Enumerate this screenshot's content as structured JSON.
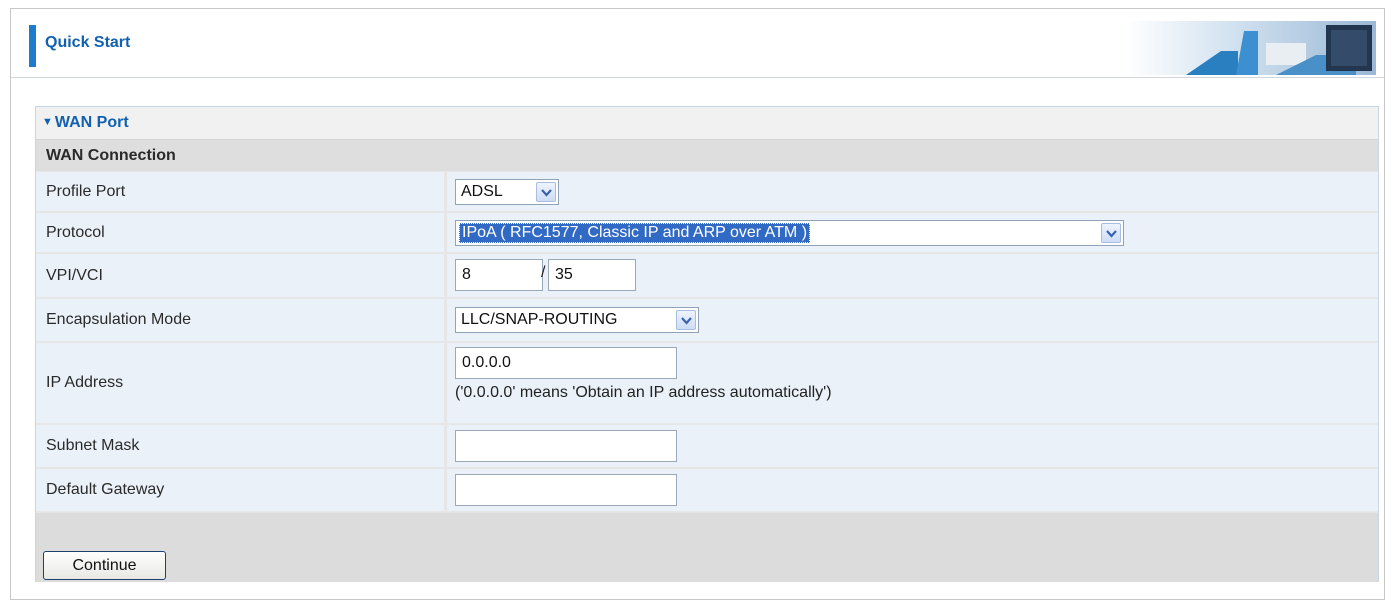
{
  "header": {
    "title": "Quick Start"
  },
  "section": {
    "title": "WAN Port",
    "subheading": "WAN Connection"
  },
  "form": {
    "profile_port": {
      "label": "Profile Port",
      "value": "ADSL"
    },
    "protocol": {
      "label": "Protocol",
      "value": "IPoA ( RFC1577, Classic IP and ARP over ATM )"
    },
    "vpi_vci": {
      "label": "VPI/VCI",
      "vpi": "8",
      "separator": "/",
      "vci": "35"
    },
    "encapsulation": {
      "label": "Encapsulation Mode",
      "value": "LLC/SNAP-ROUTING"
    },
    "ip_address": {
      "label": "IP Address",
      "value": "0.0.0.0",
      "hint": "('0.0.0.0' means 'Obtain an IP address automatically')"
    },
    "subnet_mask": {
      "label": "Subnet Mask",
      "value": ""
    },
    "default_gateway": {
      "label": "Default Gateway",
      "value": ""
    }
  },
  "buttons": {
    "continue": "Continue"
  },
  "colors": {
    "accent": "#1f7ccd",
    "title_text": "#1261b0",
    "row_background": "#eaf1f9",
    "selection_highlight": "#316ac5"
  },
  "icons": {
    "section_toggle": "caret-down-icon",
    "dropdown": "chevron-down-icon"
  }
}
